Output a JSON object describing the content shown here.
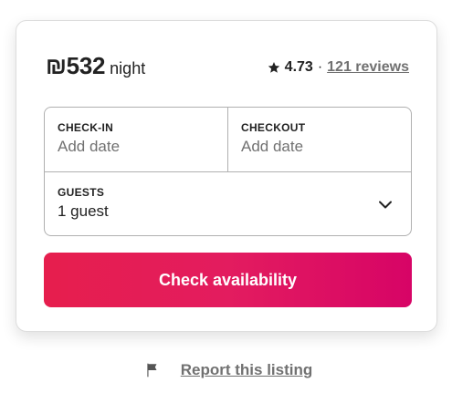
{
  "booking": {
    "price": "₪532",
    "per_night": "night",
    "rating": "4.73",
    "separator": "·",
    "reviews": "121 reviews",
    "check_in": {
      "label": "CHECK-IN",
      "value": "Add date"
    },
    "checkout": {
      "label": "CHECKOUT",
      "value": "Add date"
    },
    "guests": {
      "label": "GUESTS",
      "value": "1 guest"
    },
    "cta_label": "Check availability"
  },
  "report": {
    "label": "Report this listing"
  },
  "icons": {
    "rating": "star-icon",
    "guests_toggle": "chevron-down-icon",
    "report": "flag-icon"
  },
  "colors": {
    "cta_start": "#e61e4d",
    "cta_end": "#d70466",
    "text_primary": "#222222",
    "text_secondary": "#717171",
    "border": "#b0b0b0"
  }
}
